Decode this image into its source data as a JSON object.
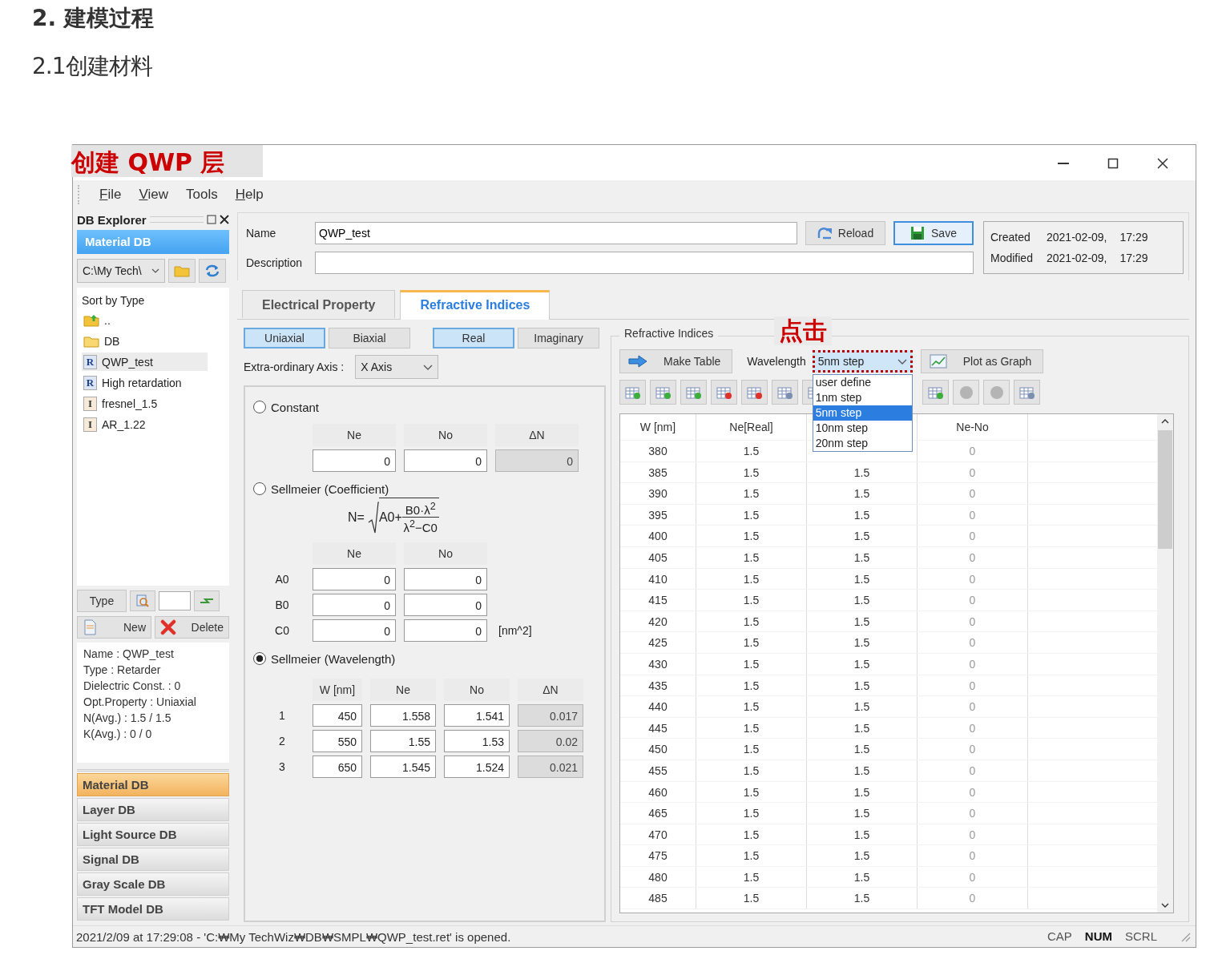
{
  "page": {
    "heading": "2. 建模过程",
    "subheading": "2.1创建材料"
  },
  "window": {
    "annotation": "创建 QWP 层",
    "controls": [
      {
        "kind": "minimize"
      },
      {
        "kind": "maximize"
      },
      {
        "kind": "close"
      }
    ]
  },
  "menu": [
    {
      "label": "File",
      "underline_first": true
    },
    {
      "label": "View",
      "underline_first": true
    },
    {
      "label": "Tools",
      "underline_first": false
    },
    {
      "label": "Help",
      "underline_first": true
    }
  ],
  "explorer": {
    "title": "DB Explorer",
    "section": "Material DB",
    "path": "C:\\My Tech\\",
    "sort_label": "Sort by Type",
    "files": [
      {
        "kind": "up",
        "label": "..",
        "selected": false
      },
      {
        "kind": "folder",
        "label": "DB",
        "selected": false
      },
      {
        "kind": "file",
        "badge": "R",
        "label": "QWP_test",
        "selected": true
      },
      {
        "kind": "file",
        "badge": "R",
        "label": "High retardation",
        "selected": false
      },
      {
        "kind": "file",
        "badge": "I",
        "label": "fresnel_1.5",
        "selected": false
      },
      {
        "kind": "file",
        "badge": "I",
        "label": "AR_1.22",
        "selected": false
      }
    ],
    "type_button": "Type",
    "new_button": "New",
    "delete_button": "Delete",
    "info": [
      "Name : QWP_test",
      "Type : Retarder",
      "Dielectric Const. : 0",
      "Opt.Property : Uniaxial",
      "N(Avg.) : 1.5 / 1.5",
      "K(Avg.) : 0 / 0"
    ],
    "nav": [
      {
        "label": "Material DB",
        "selected": true
      },
      {
        "label": "Layer DB",
        "selected": false
      },
      {
        "label": "Light Source DB",
        "selected": false
      },
      {
        "label": "Signal DB",
        "selected": false
      },
      {
        "label": "Gray Scale DB",
        "selected": false
      },
      {
        "label": "TFT Model DB",
        "selected": false
      }
    ]
  },
  "header": {
    "name_label": "Name",
    "name_value": "QWP_test",
    "description_label": "Description",
    "reload": "Reload",
    "save": "Save",
    "dates": [
      {
        "label": "Created",
        "date": "2021-02-09,",
        "time": "17:29"
      },
      {
        "label": "Modified",
        "date": "2021-02-09,",
        "time": "17:29"
      }
    ]
  },
  "tabs": [
    {
      "label": "Electrical Property",
      "selected": false
    },
    {
      "label": "Refractive Indices",
      "selected": true
    }
  ],
  "axis_buttons": [
    {
      "label": "Uniaxial",
      "selected": true
    },
    {
      "label": "Biaxial",
      "selected": false
    }
  ],
  "part_buttons": [
    {
      "label": "Real",
      "selected": true
    },
    {
      "label": "Imaginary",
      "selected": false
    }
  ],
  "extra_axis": {
    "label": "Extra-ordinary Axis :",
    "value": "X Axis"
  },
  "constant": {
    "label": "Constant",
    "selected": false,
    "columns": [
      {
        "label": "Ne",
        "readonly": false
      },
      {
        "label": "No",
        "readonly": false
      },
      {
        "label": "ΔN",
        "readonly": true
      }
    ],
    "values": [
      "0",
      "0",
      "0"
    ]
  },
  "coefficient": {
    "label": "Sellmeier (Coefficient)",
    "selected": false,
    "formula": {
      "lhs": "N=",
      "term": "A0+",
      "numerator": "B0·λ$^{2}$",
      "denominator": "λ$^{2}$−C0"
    },
    "columns": [
      "Ne",
      "No"
    ],
    "rows": [
      {
        "label": "A0",
        "values": [
          "0",
          "0"
        ]
      },
      {
        "label": "B0",
        "values": [
          "0",
          "0"
        ]
      },
      {
        "label": "C0",
        "values": [
          "0",
          "0"
        ],
        "unit": "[nm^2]"
      }
    ]
  },
  "wavelength": {
    "label": "Sellmeier (Wavelength)",
    "selected": true,
    "columns": [
      {
        "label": "W [nm]",
        "readonly": false
      },
      {
        "label": "Ne",
        "readonly": false
      },
      {
        "label": "No",
        "readonly": false
      },
      {
        "label": "ΔN",
        "readonly": true
      }
    ],
    "rows": [
      {
        "label": "1",
        "values": [
          "450",
          "1.558",
          "1.541",
          "0.017"
        ]
      },
      {
        "label": "2",
        "values": [
          "550",
          "1.55",
          "1.53",
          "0.02"
        ]
      },
      {
        "label": "3",
        "values": [
          "650",
          "1.545",
          "1.524",
          "0.021"
        ]
      }
    ]
  },
  "refractive": {
    "title": "Refractive Indices",
    "annotation": "点击",
    "make_table": "Make Table",
    "wavelength_label": "Wavelength",
    "step": "5nm step",
    "plot": "Plot as Graph",
    "step_options": [
      {
        "label": "user define",
        "selected": false
      },
      {
        "label": "1nm step",
        "selected": false
      },
      {
        "label": "5nm step",
        "selected": true
      },
      {
        "label": "10nm step",
        "selected": false
      },
      {
        "label": "20nm step",
        "selected": false
      }
    ],
    "tools_left": [
      {
        "enabled": true
      },
      {
        "enabled": true
      },
      {
        "enabled": true
      },
      {
        "enabled": true
      },
      {
        "enabled": true
      },
      {
        "enabled": true
      },
      {
        "enabled": true
      }
    ],
    "tools_right": [
      {
        "enabled": true
      },
      {
        "enabled": false
      },
      {
        "enabled": false
      },
      {
        "enabled": true
      }
    ],
    "columns": [
      "W [nm]",
      "Ne[Real]",
      null,
      "Ne-No"
    ],
    "rows": [
      [
        "380",
        "1.5",
        null,
        "0"
      ],
      [
        "385",
        "1.5",
        "1.5",
        "0"
      ],
      [
        "390",
        "1.5",
        "1.5",
        "0"
      ],
      [
        "395",
        "1.5",
        "1.5",
        "0"
      ],
      [
        "400",
        "1.5",
        "1.5",
        "0"
      ],
      [
        "405",
        "1.5",
        "1.5",
        "0"
      ],
      [
        "410",
        "1.5",
        "1.5",
        "0"
      ],
      [
        "415",
        "1.5",
        "1.5",
        "0"
      ],
      [
        "420",
        "1.5",
        "1.5",
        "0"
      ],
      [
        "425",
        "1.5",
        "1.5",
        "0"
      ],
      [
        "430",
        "1.5",
        "1.5",
        "0"
      ],
      [
        "435",
        "1.5",
        "1.5",
        "0"
      ],
      [
        "440",
        "1.5",
        "1.5",
        "0"
      ],
      [
        "445",
        "1.5",
        "1.5",
        "0"
      ],
      [
        "450",
        "1.5",
        "1.5",
        "0"
      ],
      [
        "455",
        "1.5",
        "1.5",
        "0"
      ],
      [
        "460",
        "1.5",
        "1.5",
        "0"
      ],
      [
        "465",
        "1.5",
        "1.5",
        "0"
      ],
      [
        "470",
        "1.5",
        "1.5",
        "0"
      ],
      [
        "475",
        "1.5",
        "1.5",
        "0"
      ],
      [
        "480",
        "1.5",
        "1.5",
        "0"
      ],
      [
        "485",
        "1.5",
        "1.5",
        "0"
      ]
    ]
  },
  "status": {
    "text": "2021/2/09 at 17:29:08 - 'C:₩My TechWiz₩DB₩SMPL₩QWP_test.ret' is opened.",
    "indicators": [
      {
        "label": "CAP",
        "on": false
      },
      {
        "label": "NUM",
        "on": true
      },
      {
        "label": "SCRL",
        "on": false
      }
    ]
  }
}
